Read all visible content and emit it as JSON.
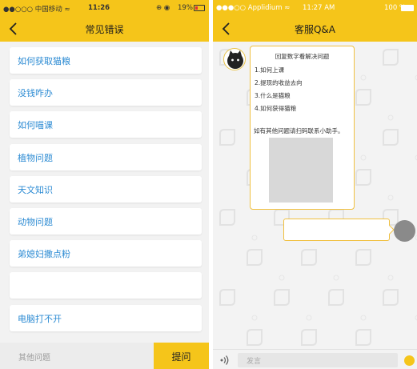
{
  "left_screen": {
    "status": {
      "carrier": "●●○○○ 中国移动 ≈",
      "time": "11:26",
      "icons": "⊕ ◉",
      "battery": "19%"
    },
    "nav": {
      "title": "常见错误"
    },
    "faq_items": [
      {
        "label": "如何获取猫粮"
      },
      {
        "label": "没钱咋办"
      },
      {
        "label": "如何喵课"
      },
      {
        "label": "植物问题"
      },
      {
        "label": "天文知识"
      },
      {
        "label": "动物问题"
      },
      {
        "label": "弟媳妇撒点粉"
      },
      {
        "label": ""
      },
      {
        "label": "电脑打不开"
      }
    ],
    "bottom": {
      "placeholder": "其他问题",
      "submit_label": "提问"
    },
    "colors": {
      "accent": "#f5c51a",
      "link": "#2c8bd3"
    }
  },
  "right_screen": {
    "status": {
      "carrier": "●●●○○ Applidium ≈",
      "time": "11:27 AM",
      "battery": "100 %"
    },
    "nav": {
      "title": "客服Q&A"
    },
    "bot_message": {
      "header": "回复数字看解决问题",
      "options": [
        "1.如何上课",
        "2.提现的收益去向",
        "3.什么是猫粮",
        "4.如何获得猫粮"
      ],
      "note": "如有其他问题请扫码联系小助手。"
    },
    "bottom": {
      "placeholder": "发言"
    }
  }
}
